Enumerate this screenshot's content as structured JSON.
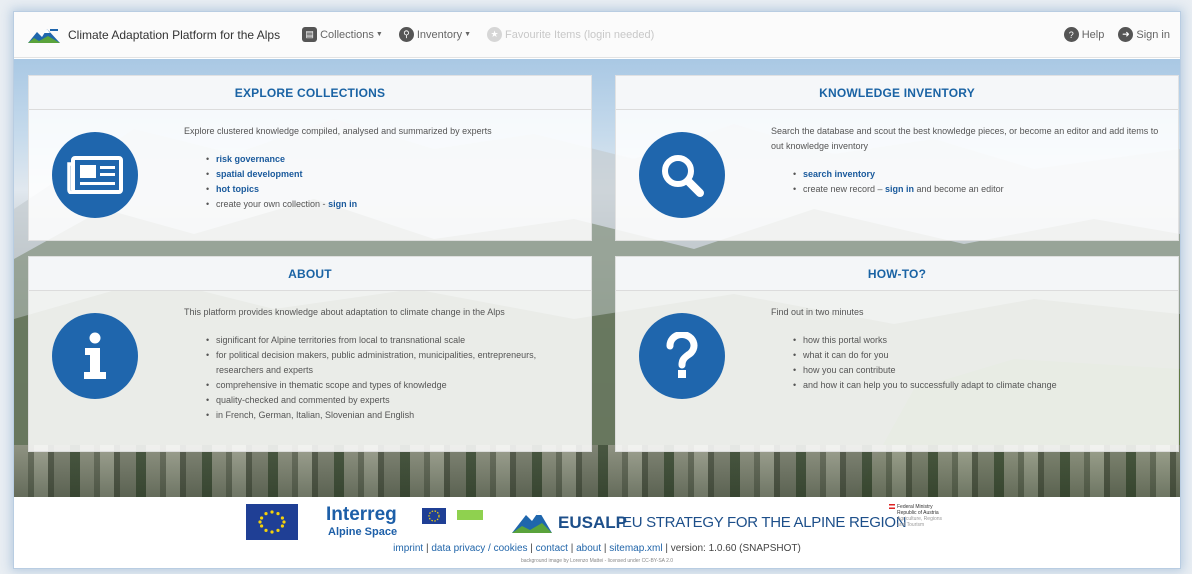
{
  "navbar": {
    "brand_title": "Climate Adaptation Platform for the Alps",
    "collections_label": "Collections",
    "inventory_label": "Inventory",
    "favourite_label": "Favourite Items (login needed)",
    "help_label": "Help",
    "signin_label": "Sign in"
  },
  "panels": {
    "explore": {
      "title": "EXPLORE COLLECTIONS",
      "intro": "Explore clustered knowledge compiled, analysed and summarized by experts",
      "link1": "risk governance",
      "link2": "spatial development",
      "link3": "hot topics",
      "item4_text": "create your own collection - ",
      "item4_link": "sign in"
    },
    "inventory": {
      "title": "KNOWLEDGE INVENTORY",
      "intro": "Search the database and scout the best knowledge pieces, or become an editor and add items to out knowledge inventory",
      "link1": "search inventory",
      "item2_text": "create new record – ",
      "item2_link": "sign in",
      "item2_suffix": " and become an editor"
    },
    "about": {
      "title": "ABOUT",
      "intro": "This platform provides knowledge about adaptation to climate change in the Alps",
      "items": [
        "significant for Alpine territories from local to transnational scale",
        "for political decision makers, public administration, municipalities, entrepreneurs, researchers and experts",
        "comprehensive in thematic scope and types of knowledge",
        "quality-checked and commented by experts",
        "in French, German, Italian, Slovenian and English"
      ]
    },
    "howto": {
      "title": "HOW-TO?",
      "intro": "Find out in two minutes",
      "items": [
        "how this portal works",
        "what it can do for you",
        "how you can contribute",
        "and how it can help you to successfully adapt to climate change"
      ]
    }
  },
  "footer": {
    "interreg_title": "Interreg",
    "interreg_sub": "Alpine Space",
    "eusalp_label": "EUSALP",
    "eusalp_tagline": "EU STRATEGY FOR THE ALPINE REGION",
    "ministry_line1": "Federal Ministry",
    "ministry_line2": "Republic of Austria",
    "ministry_line3": "Agriculture, Regions",
    "ministry_line4": "and Tourism",
    "links": {
      "imprint": "imprint",
      "privacy": "data privacy / cookies",
      "contact": "contact",
      "about": "about",
      "sitemap": "sitemap.xml",
      "version": "version: 1.0.60 (SNAPSHOT)"
    },
    "credit": "background image by Lorenzo Mattei - licensed under CC-BY-SA 2.0"
  },
  "colors": {
    "primary_blue": "#1f66ad",
    "heading_blue": "#1a63a4",
    "link_blue": "#1a5a9c"
  },
  "icons": [
    "mountain-logo-icon",
    "collections-icon",
    "search-icon",
    "star-icon",
    "question-icon",
    "signin-icon",
    "newspaper-icon",
    "magnifier-icon",
    "info-icon",
    "question-mark-icon"
  ]
}
